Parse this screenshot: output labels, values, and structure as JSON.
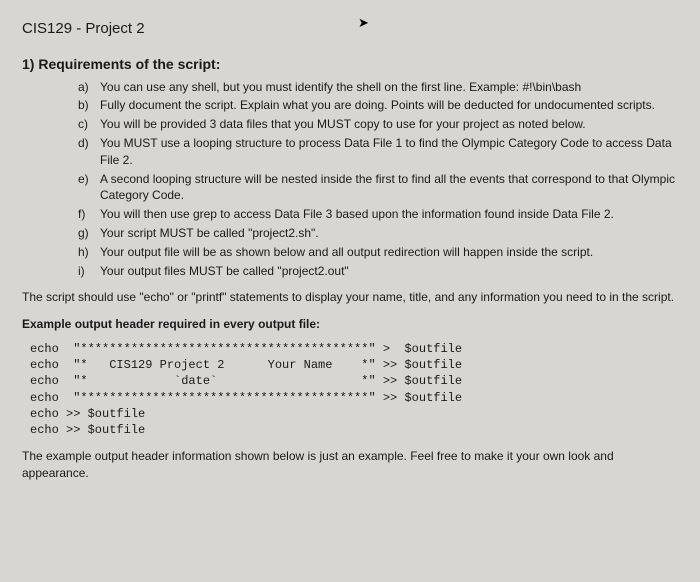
{
  "title": "CIS129 - Project 2",
  "section_header": "1) Requirements of the script:",
  "requirements": [
    {
      "marker": "a)",
      "text": "You can use any shell, but you must identify the shell on the first line.  Example: #!\\bin\\bash"
    },
    {
      "marker": "b)",
      "text": "Fully document the script. Explain what you are doing. Points will be deducted for undocumented scripts."
    },
    {
      "marker": "c)",
      "text": "You will be provided 3 data files that you MUST copy to use for your project as noted below."
    },
    {
      "marker": "d)",
      "text": "You MUST use a looping structure to process Data File 1 to find the Olympic Category Code to access Data File 2."
    },
    {
      "marker": "e)",
      "text": "A second looping structure will be nested inside the first to find all the events that correspond to that Olympic Category Code."
    },
    {
      "marker": "f)",
      "text": "You will then use grep to access Data File 3 based upon the information found inside Data File 2."
    },
    {
      "marker": "g)",
      "text": "Your script MUST be called \"project2.sh\"."
    },
    {
      "marker": "h)",
      "text": "Your output file will be as shown below and all output redirection will happen inside the script."
    },
    {
      "marker": "i)",
      "text": "Your output files MUST be called \"project2.out\""
    }
  ],
  "para1": "The script should use \"echo\" or \"printf\" statements to display your name, title, and any information you need to in the script.",
  "bold_para": "Example output header required in every output file:",
  "code_block": "echo  \"****************************************\" >  $outfile\necho  \"*   CIS129 Project 2      Your Name    *\" >> $outfile\necho  \"*            `date`                    *\" >> $outfile\necho  \"****************************************\" >> $outfile\necho >> $outfile\necho >> $outfile",
  "closing": "The example output header information shown below is just an example.  Feel free to make it your own look and appearance."
}
